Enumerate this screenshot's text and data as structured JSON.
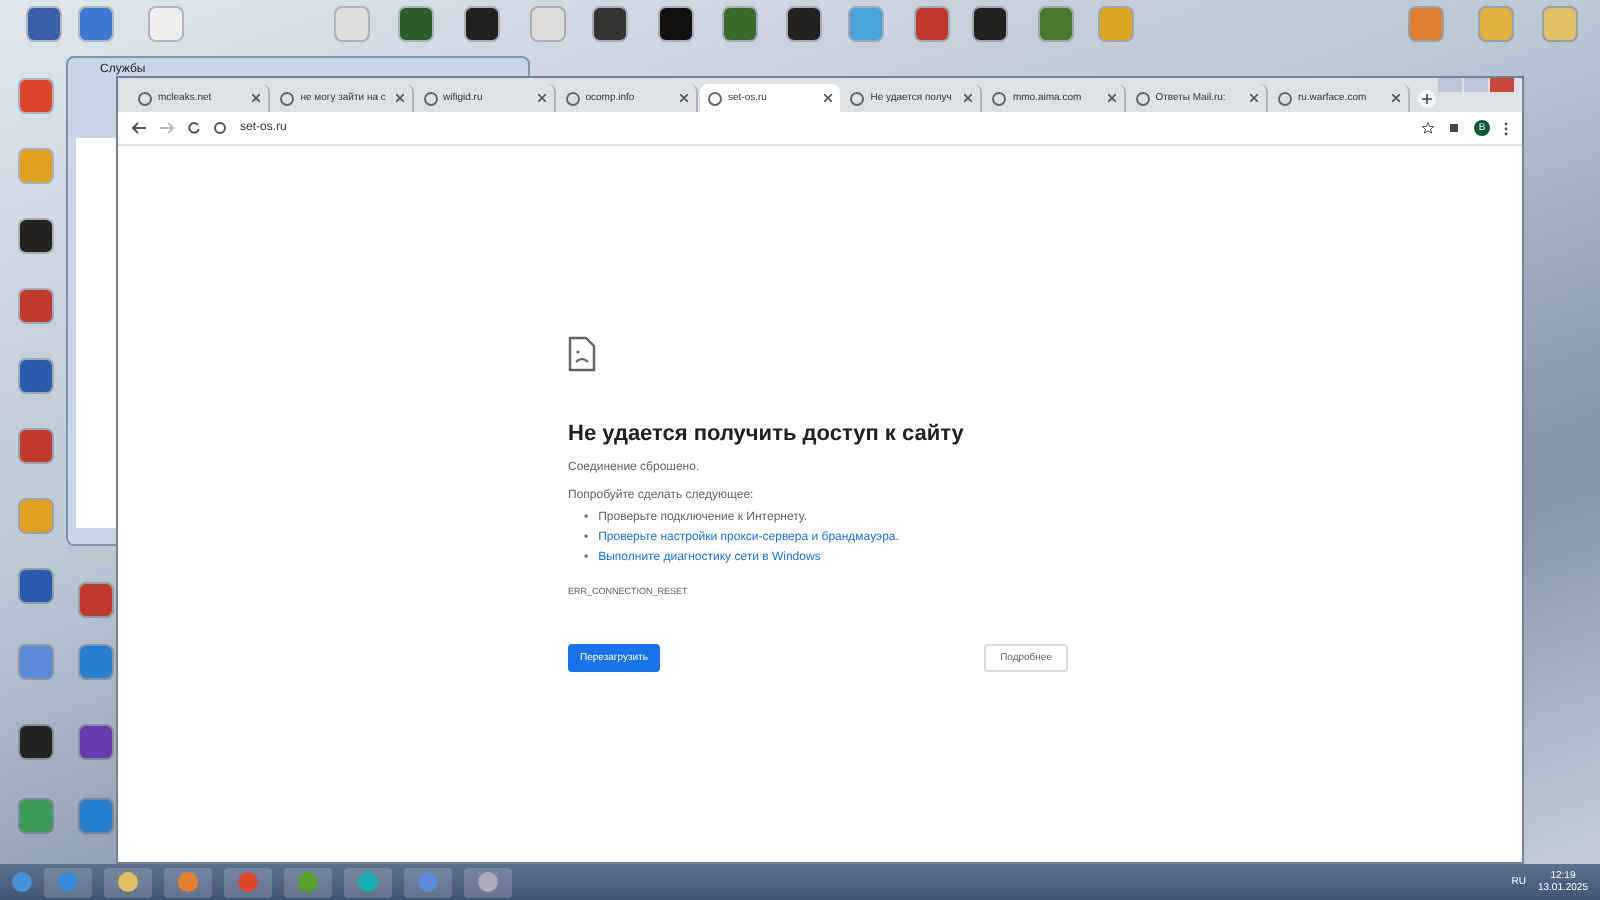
{
  "background_window": {
    "title": "Службы"
  },
  "browser": {
    "tabs": [
      {
        "title": "mcleaks.net",
        "selected": false
      },
      {
        "title": "не могу зайти на с",
        "selected": false
      },
      {
        "title": "wifigid.ru",
        "selected": false
      },
      {
        "title": "ocomp.info",
        "selected": false
      },
      {
        "title": "set-os.ru",
        "selected": true
      },
      {
        "title": "Не удается получ",
        "selected": false
      },
      {
        "title": "mmo.aima.com",
        "selected": false
      },
      {
        "title": "Ответы Mail.ru: ",
        "selected": false
      },
      {
        "title": "ru.warface.com",
        "selected": false
      }
    ],
    "address": "set-os.ru",
    "profile": "B"
  },
  "error_page": {
    "heading": "Не удается получить доступ к сайту",
    "subtitle": "Соединение сброшено.",
    "try_label": "Попробуйте сделать следующее:",
    "suggestions": [
      {
        "bullet": "•",
        "text": "Проверьте подключение к Интернету.",
        "kind": "plain"
      },
      {
        "bullet": "•",
        "text": "Проверьте настройки прокси-сервера и брандмауэра.",
        "kind": "link"
      },
      {
        "bullet": "•",
        "text": "Выполните диагностику сети в Windows",
        "kind": "link"
      }
    ],
    "error_code": "ERR_CONNECTION_RESET",
    "reload_button": "Перезагрузить",
    "details_button": "Подробнее"
  },
  "taskbar": {
    "language": "RU",
    "time": "12:19",
    "date": "13.01.2025"
  }
}
